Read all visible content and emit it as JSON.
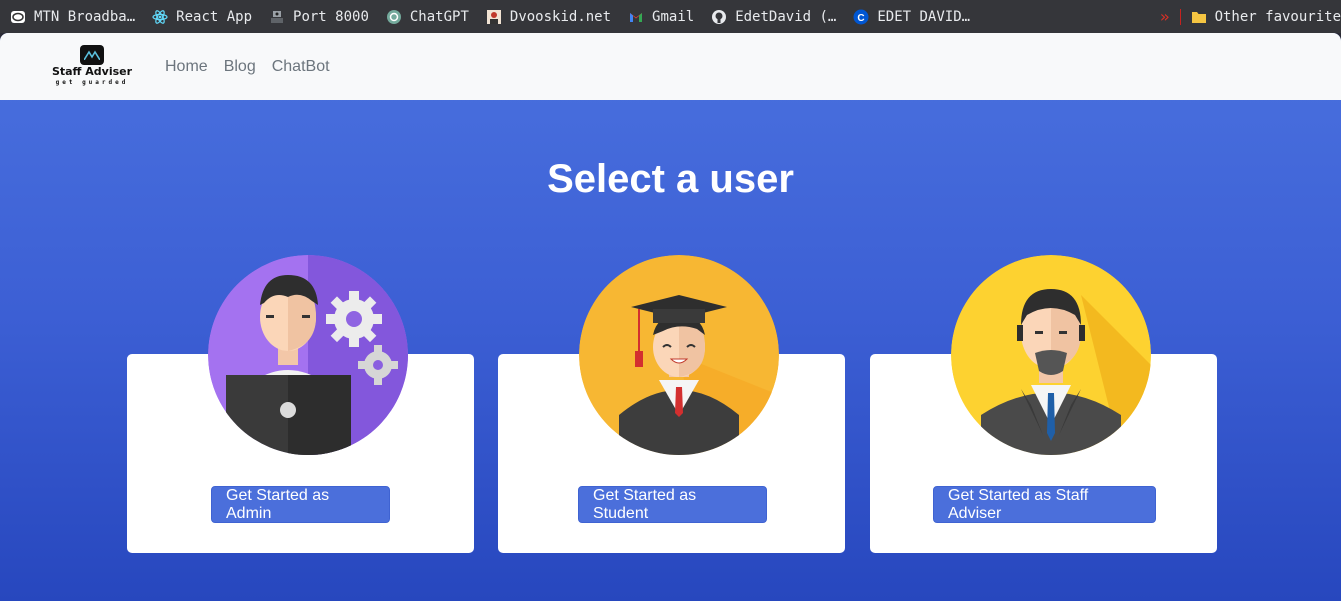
{
  "bookmarks": [
    {
      "label": "MTN Broadba…",
      "icon": "mtn-icon"
    },
    {
      "label": "React App",
      "icon": "react-icon"
    },
    {
      "label": "Port 8000",
      "icon": "port-icon"
    },
    {
      "label": "ChatGPT",
      "icon": "chatgpt-icon"
    },
    {
      "label": "Dvooskid.net",
      "icon": "dvooskid-icon"
    },
    {
      "label": "Gmail",
      "icon": "gmail-icon"
    },
    {
      "label": "EdetDavid (…",
      "icon": "github-icon"
    },
    {
      "label": "EDET DAVID…",
      "icon": "coursera-icon"
    }
  ],
  "other_favourites": "Other favourite",
  "brand": {
    "title": "Staff Adviser",
    "subtitle": "get guarded"
  },
  "nav": [
    "Home",
    "Blog",
    "ChatBot"
  ],
  "heading": "Select a user",
  "cards": [
    {
      "role": "admin",
      "button": "Get Started as Admin",
      "avatar_bg": "#8a5fe0"
    },
    {
      "role": "student",
      "button": "Get Started as Student",
      "avatar_bg": "#f7b733"
    },
    {
      "role": "staff-adviser",
      "button": "Get Started as Staff Adviser",
      "avatar_bg": "#fbc92a"
    }
  ],
  "colors": {
    "accent": "#4b6fdb",
    "page_top": "#4a71df",
    "page_bottom": "#2747be"
  }
}
